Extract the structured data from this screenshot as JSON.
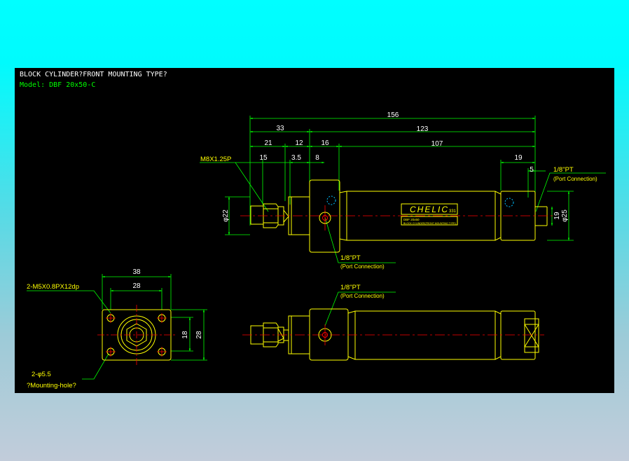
{
  "drawing": {
    "title": "BLOCK CYLINDER?FRONT MOUNTING TYPE?",
    "model": "Model: DBF 20x50-C"
  },
  "side_view": {
    "dims_top": [
      "156",
      "33",
      "123",
      "21",
      "12",
      "16",
      "107",
      "15",
      "3.5",
      "8",
      "19",
      "5"
    ],
    "thread_label": "M8X1.25P",
    "port_right": {
      "size": "1/8\"PT",
      "note": "(Port Connection)"
    },
    "port_front": {
      "size": "1/8\"PT",
      "note": "(Port Connection)"
    },
    "dia_rod": "φ22",
    "dia_end": "φ25",
    "dim_end_height": "19",
    "brand": "CHELIC",
    "brand_code": "331",
    "label_line1": "DBF 20x50",
    "label_line2": "BLOCK CYLINDER(FRONT MOUNTING TYPE)"
  },
  "front_view": {
    "dim_38": "38",
    "dim_28_top": "28",
    "dim_18": "18",
    "dim_28_right": "28",
    "thread_holes": "2-M5X0.8PX12dp",
    "mount_holes": "2-φ5.5",
    "mount_note": "?Mounting-hole?"
  },
  "top_view": {
    "port": {
      "size": "1/8\"PT",
      "note": "(Port Connection)"
    }
  },
  "colors": {
    "background": "#000000",
    "outline": "#ffff00",
    "dimension": "#00ff00",
    "centerline": "#ff0000",
    "text": "#ffffff",
    "port_marker": "#00bfff"
  }
}
